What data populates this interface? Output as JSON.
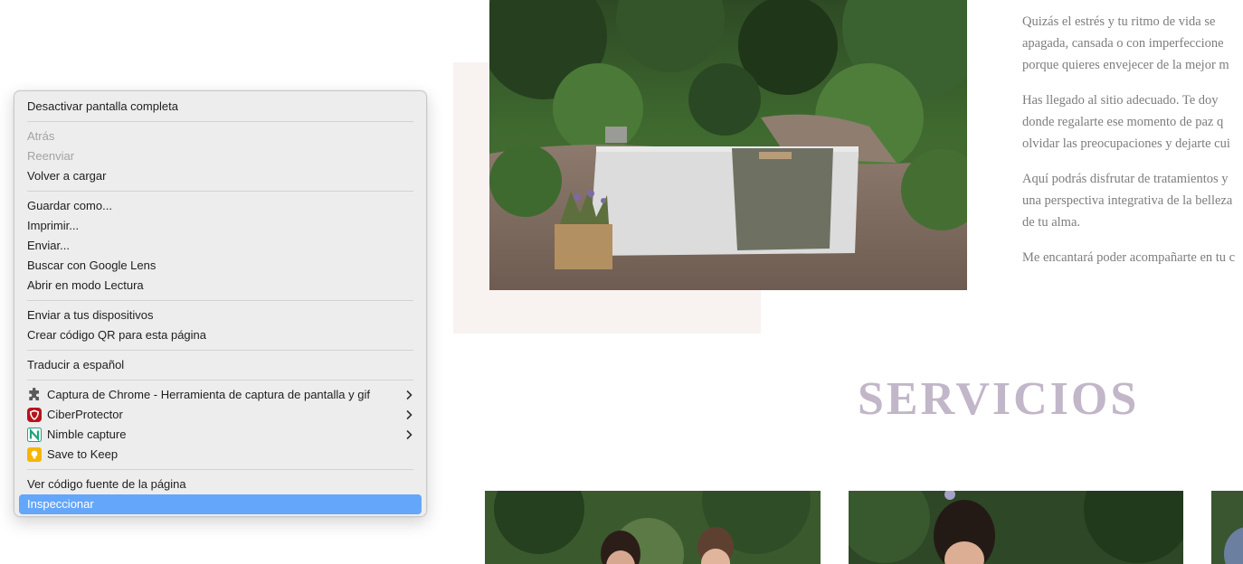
{
  "website": {
    "intro_paragraphs": [
      {
        "lines": [
          "Quizás el estrés y tu ritmo de vida se",
          "apagada, cansada o con imperfeccione",
          "porque quieres envejecer de la mejor m"
        ]
      },
      {
        "lines": [
          "Has llegado al sitio adecuado. Te doy",
          "donde regalarte ese momento de paz q",
          "olvidar las preocupaciones y dejarte cui"
        ]
      },
      {
        "lines": [
          "Aquí podrás disfrutar de tratamientos y",
          "una perspectiva integrativa de la belleza",
          "de tu alma."
        ]
      },
      {
        "lines": [
          "Me encantará poder acompañarte en tu c"
        ]
      }
    ],
    "services_title": "SERVICIOS",
    "colors": {
      "title": "#c2b6c9",
      "text": "#7d7d7d",
      "pink_block": "#f8f2f1"
    }
  },
  "context_menu": {
    "groups": [
      [
        {
          "label": "Desactivar pantalla completa",
          "enabled": true
        }
      ],
      [
        {
          "label": "Atrás",
          "enabled": false
        },
        {
          "label": "Reenviar",
          "enabled": false
        },
        {
          "label": "Volver a cargar",
          "enabled": true
        }
      ],
      [
        {
          "label": "Guardar como...",
          "enabled": true
        },
        {
          "label": "Imprimir...",
          "enabled": true
        },
        {
          "label": "Enviar...",
          "enabled": true
        },
        {
          "label": "Buscar con Google Lens",
          "enabled": true
        },
        {
          "label": "Abrir en modo Lectura",
          "enabled": true
        }
      ],
      [
        {
          "label": "Enviar a tus dispositivos",
          "enabled": true
        },
        {
          "label": "Crear código QR para esta página",
          "enabled": true
        }
      ],
      [
        {
          "label": "Traducir a español",
          "enabled": true
        }
      ],
      [
        {
          "label": "Captura de Chrome - Herramienta de captura de pantalla y gif",
          "icon": "puzzle-icon",
          "submenu": true,
          "enabled": true
        },
        {
          "label": "CiberProtector",
          "icon": "ciberprotector-shield-icon",
          "submenu": true,
          "enabled": true
        },
        {
          "label": "Nimble capture",
          "icon": "nimble-n-icon",
          "submenu": true,
          "enabled": true
        },
        {
          "label": "Save to Keep",
          "icon": "keep-bulb-icon",
          "submenu": false,
          "enabled": true
        }
      ],
      [
        {
          "label": "Ver código fuente de la página",
          "enabled": true
        },
        {
          "label": "Inspeccionar",
          "enabled": true,
          "highlighted": true
        }
      ]
    ],
    "colors": {
      "highlight": "#64a6fa",
      "background": "#ececec",
      "disabled_text": "#a3a3a3"
    }
  }
}
